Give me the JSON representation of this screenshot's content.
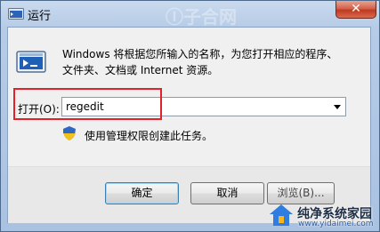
{
  "window": {
    "title": "运行",
    "close_symbol": "✕",
    "header_watermark": "Ⓘ子合网"
  },
  "description": {
    "line1": "Windows 将根据您所输入的名称，为您打开相应的程序、",
    "line2": "文件夹、文档或 Internet 资源。"
  },
  "open_field": {
    "label": "打开(O):",
    "value": "regedit"
  },
  "admin_note": "使用管理权限创建此任务。",
  "buttons": {
    "ok": "确定",
    "cancel": "取消",
    "browse": "浏览(B)..."
  },
  "watermark": {
    "title": "纯净系统家园",
    "url": "www.yidaimei.com"
  },
  "icons": {
    "title": "run-icon",
    "main": "run-program-icon",
    "shield": "uac-shield-icon",
    "dropdown": "chevron-down-icon",
    "watermark": "house-logo-icon"
  },
  "colors": {
    "highlight": "#e4202a",
    "close": "#c0391f",
    "frame": "#aac2e2"
  }
}
